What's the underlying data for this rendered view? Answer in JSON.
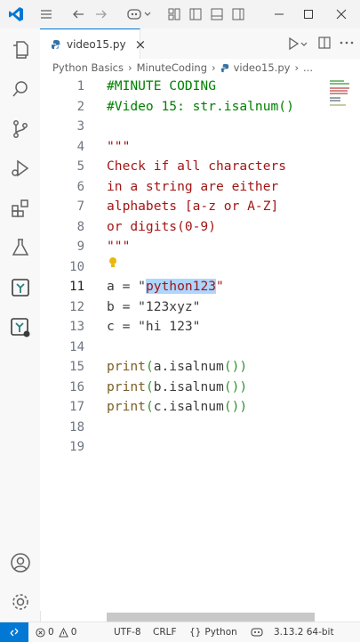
{
  "tab": {
    "filename": "video15.py",
    "close": "×"
  },
  "breadcrumb": {
    "folder1": "Python Basics",
    "sep": "›",
    "folder2": "MinuteCoding",
    "file": "video15.py",
    "more": "..."
  },
  "editor": {
    "line_numbers": [
      "1",
      "2",
      "3",
      "4",
      "5",
      "6",
      "7",
      "8",
      "9",
      "10",
      "11",
      "12",
      "13",
      "14",
      "15",
      "16",
      "17",
      "18",
      "19"
    ],
    "lines": {
      "l1": "#MINUTE CODING",
      "l2": "#Video 15: str.isalnum()",
      "l4": "\"\"\"",
      "l5": "Check if all characters",
      "l6": "in a string are either",
      "l7": "alphabets [a-z or A-Z]",
      "l8": "or digits(0-9)",
      "l9": "\"\"\"",
      "l11_pre": "a = \"",
      "l11_sel": "python123",
      "l11_post": "\"",
      "l12": "b = \"123xyz\"",
      "l13": "c = \"hi 123\"",
      "l15_fn": "print",
      "l15_arg": "a.isalnum",
      "l16_fn": "print",
      "l16_arg": "b.isalnum",
      "l17_fn": "print",
      "l17_arg": "c.isalnum"
    }
  },
  "statusbar": {
    "errors": "0",
    "warnings": "0",
    "encoding": "UTF-8",
    "eol": "CRLF",
    "language": "Python",
    "language_brackets": "{}",
    "interpreter": "3.13.2 64-bit"
  },
  "colors": {
    "accent": "#0078d4",
    "comment": "#008000",
    "string": "#a31515",
    "selection": "#add6ff"
  },
  "icons": [
    "vscode-logo-icon",
    "menu-icon",
    "back-arrow-icon",
    "forward-arrow-icon",
    "copilot-icon",
    "layout-icon",
    "toggle-primary-sidebar-icon",
    "toggle-panel-icon",
    "toggle-secondary-sidebar-icon",
    "minimize-icon",
    "maximize-icon",
    "close-icon",
    "explorer-icon",
    "search-icon",
    "source-control-icon",
    "run-debug-icon",
    "extensions-icon",
    "testing-icon",
    "minute-coding-icon",
    "minute-coding-notify-icon",
    "account-icon",
    "settings-gear-icon",
    "python-file-icon",
    "run-icon",
    "split-editor-icon",
    "more-actions-icon",
    "lightbulb-icon",
    "remote-icon",
    "error-icon",
    "warning-icon"
  ]
}
